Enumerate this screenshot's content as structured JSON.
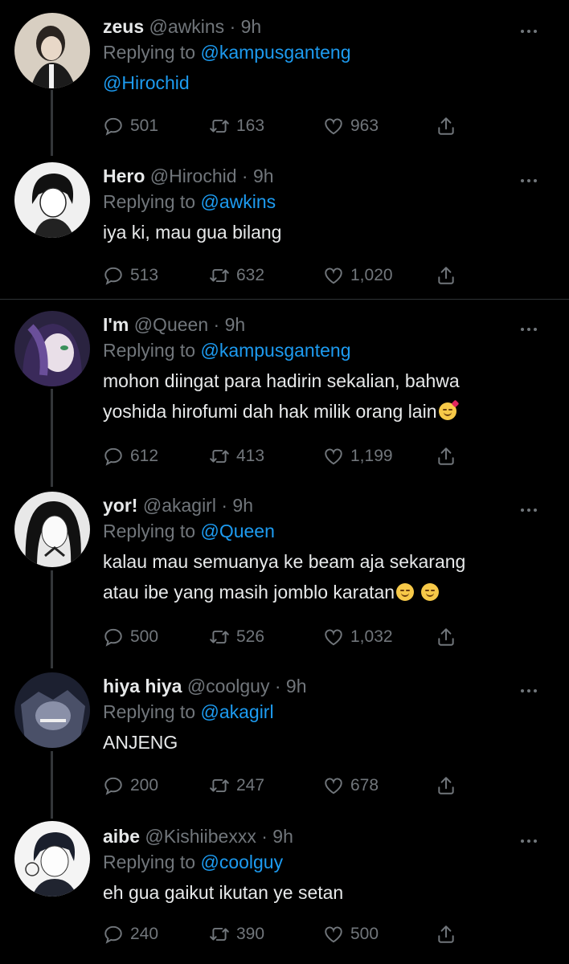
{
  "tweets": [
    {
      "name": "zeus",
      "handle": "@awkins",
      "time": "9h",
      "replying_label": "Replying to",
      "replying_to": "@kampusganteng",
      "text": "@Hirochid",
      "replies": "501",
      "retweets": "163",
      "likes": "963"
    },
    {
      "name": "Hero",
      "handle": "@Hirochid",
      "time": "9h",
      "replying_label": "Replying to",
      "replying_to": "@awkins",
      "text": "iya ki, mau gua bilang",
      "replies": "513",
      "retweets": "632",
      "likes": "1,020"
    },
    {
      "name": "I'm",
      "handle": "@Queen",
      "time": "9h",
      "replying_label": "Replying to",
      "replying_to": "@kampusganteng",
      "text_line1": "mohon diingat para hadirin sekalian, bahwa",
      "text_line2": "yoshida hirofumi dah hak milik orang lain",
      "replies": "612",
      "retweets": "413",
      "likes": "1,199"
    },
    {
      "name": "yor!",
      "handle": "@akagirl",
      "time": "9h",
      "replying_label": "Replying to",
      "replying_to": "@Queen",
      "text_line1": "kalau mau semuanya ke beam aja sekarang",
      "text_line2": "atau ibe yang masih jomblo karatan",
      "replies": "500",
      "retweets": "526",
      "likes": "1,032"
    },
    {
      "name": "hiya hiya",
      "handle": "@coolguy",
      "time": "9h",
      "replying_label": "Replying to",
      "replying_to": "@akagirl",
      "text": "ANJENG",
      "replies": "200",
      "retweets": "247",
      "likes": "678"
    },
    {
      "name": "aibe",
      "handle": "@Kishiibexxx",
      "time": "9h",
      "replying_label": "Replying to",
      "replying_to": "@coolguy",
      "text": "eh gua gaikut ikutan ye setan",
      "replies": "240",
      "retweets": "390",
      "likes": "500"
    }
  ],
  "separator": "·",
  "icons": {
    "reply": "reply-icon",
    "retweet": "retweet-icon",
    "like": "heart-icon",
    "share": "share-icon",
    "more": "more-icon"
  },
  "colors": {
    "background": "#000000",
    "text": "#e7e9ea",
    "muted": "#71767b",
    "link": "#1d9bf0"
  }
}
